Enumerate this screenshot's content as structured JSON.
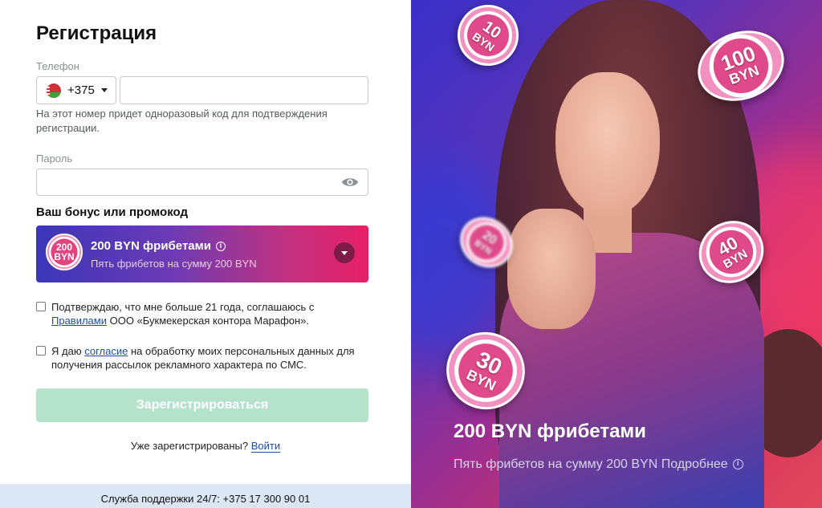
{
  "form": {
    "title": "Регистрация",
    "phone_label": "Телефон",
    "country_code": "+375",
    "phone_value": "",
    "phone_hint": "На этот номер придет одноразовый код для подтверждения регистрации.",
    "password_label": "Пароль",
    "password_value": "",
    "bonus_title": "Ваш бонус или промокод",
    "bonus": {
      "coin_amount": "200",
      "coin_currency": "BYN",
      "name": "200 BYN фрибетами",
      "description": "Пять фрибетов на сумму 200 BYN"
    },
    "consent_age": {
      "text_before": "Подтверждаю, что мне больше 21 года, соглашаюсь с",
      "link": "Правилами",
      "text_after": "ООО «Букмекерская контора Марафон»."
    },
    "consent_data": {
      "text_before": "Я даю",
      "link": "согласие",
      "text_after": "на обработку моих персональных данных для получения рассылок рекламного характера по СМС."
    },
    "register_button": "Зарегистрироваться",
    "already_text": "Уже зарегистрированы?",
    "login_link": "Войти"
  },
  "support": {
    "text": "Служба поддержки 24/7: +375 17 300 90 01"
  },
  "promo": {
    "title": "200 BYN фрибетами",
    "description": "Пять фрибетов на сумму 200 BYN Подробнее",
    "coins": [
      {
        "amount": "10",
        "currency": "BYN"
      },
      {
        "amount": "100",
        "currency": "BYN"
      },
      {
        "amount": "20",
        "currency": "BYN"
      },
      {
        "amount": "40",
        "currency": "BYN"
      },
      {
        "amount": "30",
        "currency": "BYN"
      }
    ]
  },
  "colors": {
    "accent_link": "#1b4fa8",
    "register_disabled": "#b5e2cb",
    "bonus_gradient_start": "#3b36b8",
    "bonus_gradient_end": "#e81f66",
    "support_bar": "#dbe7f4"
  },
  "icons": {
    "flag": "belarus-flag-icon",
    "eye": "eye-icon",
    "info": "info-icon",
    "dropdown": "chevron-down-icon"
  }
}
